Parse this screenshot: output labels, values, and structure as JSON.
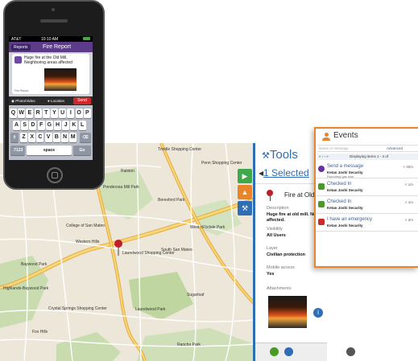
{
  "phone": {
    "status_carrier": "AT&T",
    "status_time": "10:10 AM",
    "nav_back": "Reports",
    "nav_title": "Fire Report",
    "report_text": "Huge fire at the Old Mill, Neighboring areas affected",
    "location_small": "Fire Report",
    "toolbar_photo": "Photo/Video",
    "toolbar_location": "Location",
    "toolbar_send": "Send",
    "keyboard_rows": [
      [
        "Q",
        "W",
        "E",
        "R",
        "T",
        "Y",
        "U",
        "I",
        "O",
        "P"
      ],
      [
        "A",
        "S",
        "D",
        "F",
        "G",
        "H",
        "J",
        "K",
        "L"
      ],
      [
        "Z",
        "X",
        "C",
        "V",
        "B",
        "N",
        "M"
      ]
    ],
    "key_numbers": ".?123",
    "key_space": "space",
    "key_return": "Go"
  },
  "map": {
    "labels": [
      "Tools",
      "Trindle Shopping Center",
      "Penn Shopping Center",
      "Beresford Park",
      "Ponderosa Mill Park",
      "Laurelwood Shopping Center",
      "South San Mateo",
      "West Hillsdale Park",
      "Hills Park",
      "Laurelwood Park",
      "Sugarloaf",
      "Highlands-Baywood Park",
      "Crystal Springs Shopping Center",
      "Crystal Springs",
      "College of San Mateo",
      "Western Hills",
      "Baywood Park",
      "Fox Hills",
      "Rancho Park",
      "Ralston"
    ]
  },
  "tools": {
    "title": "Tools",
    "selected": "1 Selected",
    "item_title": "Fire at Old",
    "description_label": "Description",
    "description_value": "Huge fire at old mill. Neig affected.",
    "visibility_label": "Visibility",
    "visibility_value": "All Users",
    "layer_label": "Layer",
    "layer_value": "Civilian protection",
    "mobile_label": "Mobile access",
    "mobile_value": "Yes",
    "attachments_label": "Attachments"
  },
  "events": {
    "title": "Events",
    "search_placeholder": "Name or message",
    "advanced": "Advanced",
    "paging": "Displaying items 1 - 4 of",
    "items": [
      {
        "title": "Send a message",
        "subtitle": "Ketan Joshi Security",
        "detail": "Reporting gas leak",
        "time": "< 30m",
        "color": "#6b2fa0"
      },
      {
        "title": "Checked In",
        "subtitle": "Ketan Joshi Security",
        "detail": "",
        "time": "< 1m",
        "color": "#4a9a2a"
      },
      {
        "title": "Checked In",
        "subtitle": "Ketan Joshi Security",
        "detail": "",
        "time": "< 1m",
        "color": "#4a9a2a"
      },
      {
        "title": "I have an emergency",
        "subtitle": "Ketan Joshi Security",
        "detail": "",
        "time": "< 2m",
        "color": "#cc2a2a"
      }
    ]
  },
  "colors": {
    "accent": "#2f6db5",
    "events_orange": "#e8852a",
    "phone_nav": "#5c3c88",
    "send_red": "#d0262a"
  }
}
